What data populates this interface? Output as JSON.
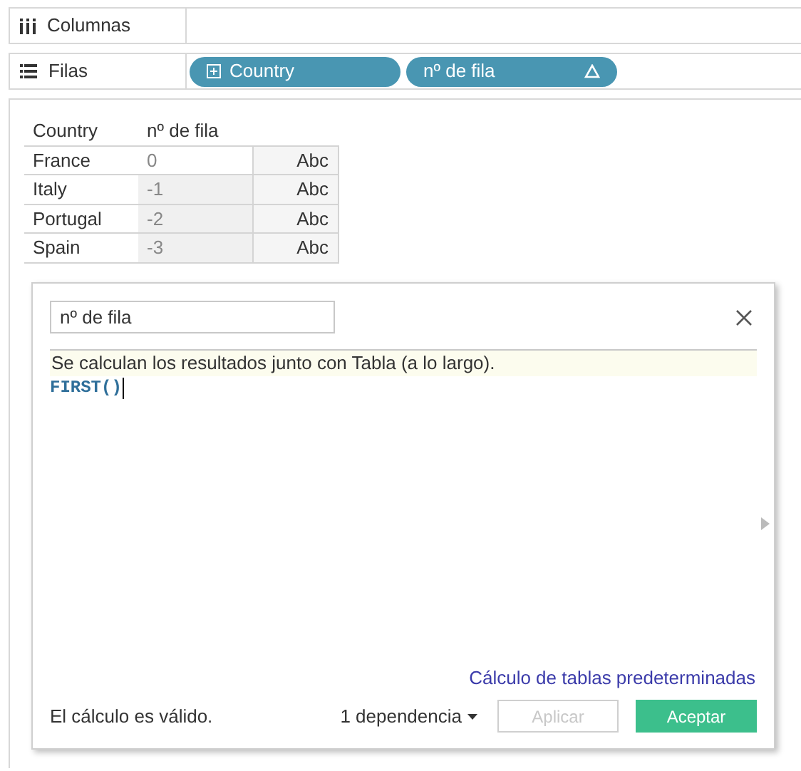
{
  "shelves": [
    {
      "kind": "columns",
      "label": "Columnas"
    },
    {
      "kind": "rows",
      "label": "Filas",
      "pills": [
        {
          "label": "Country",
          "kind": "dimension"
        },
        {
          "label": "nº de fila",
          "kind": "calc"
        }
      ]
    }
  ],
  "table": {
    "columns": [
      "Country",
      "nº de fila"
    ],
    "rows": [
      {
        "cells": [
          "France",
          "0",
          "Abc"
        ]
      },
      {
        "cells": [
          "Italy",
          "-1",
          "Abc"
        ]
      },
      {
        "cells": [
          "Portugal",
          "-2",
          "Abc"
        ]
      },
      {
        "cells": [
          "Spain",
          "-3",
          "Abc"
        ]
      }
    ]
  },
  "dialog": {
    "name_field": {
      "value": "nº de fila"
    },
    "info": "Se calculan los resultados junto con Tabla (a lo largo).",
    "formula": "FIRST()",
    "link": "Cálculo de tablas predeterminadas",
    "status": "El cálculo es válido.",
    "dependencies": "1 dependencia",
    "buttons": [
      {
        "label": "Aplicar",
        "disabled": true
      },
      {
        "label": "Aceptar",
        "disabled": false
      }
    ]
  }
}
